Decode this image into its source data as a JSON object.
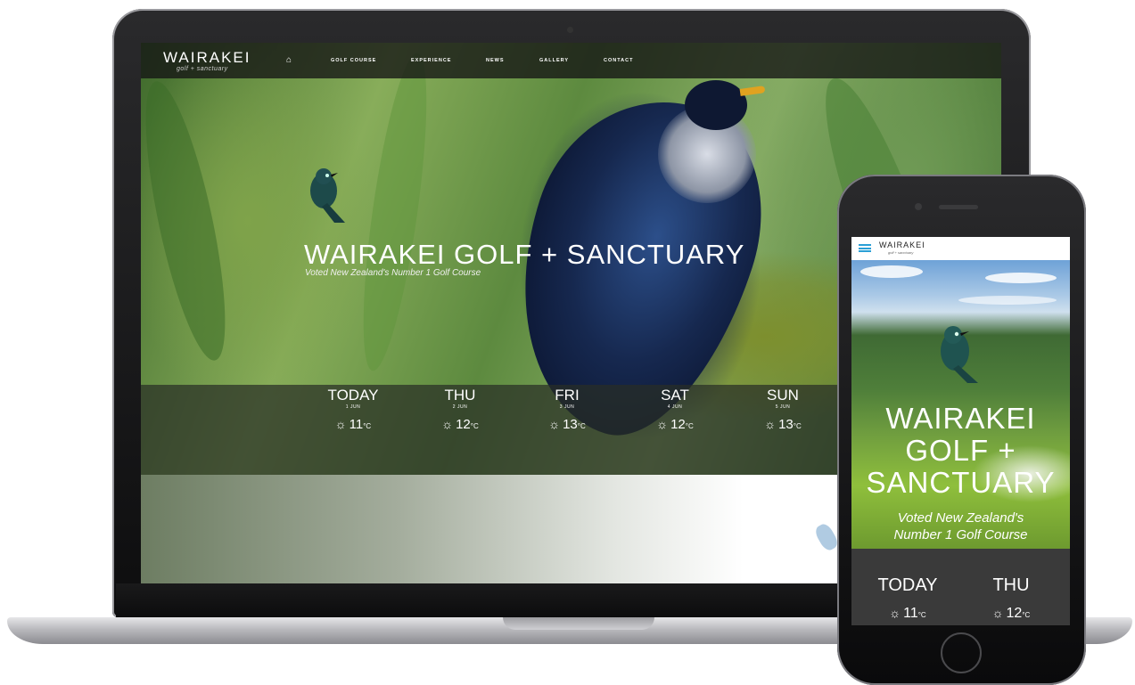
{
  "desktop": {
    "logo": {
      "main": "WAIRAKEI",
      "sub": "golf + sanctuary"
    },
    "nav": {
      "home_icon": "home-icon",
      "items": [
        "GOLF COURSE",
        "EXPERIENCE",
        "NEWS",
        "GALLERY",
        "CONTACT"
      ]
    },
    "hero": {
      "title": "WAIRAKEI GOLF + SANCTUARY",
      "subtitle": "Voted New Zealand's Number 1 Golf Course"
    },
    "weather": [
      {
        "day": "TODAY",
        "date": "1 JUN",
        "temp": "11",
        "unit": "°C",
        "icon": "sun-icon"
      },
      {
        "day": "THU",
        "date": "2 JUN",
        "temp": "12",
        "unit": "°C",
        "icon": "sun-icon"
      },
      {
        "day": "FRI",
        "date": "3 JUN",
        "temp": "13",
        "unit": "°C",
        "icon": "sun-icon"
      },
      {
        "day": "SAT",
        "date": "4 JUN",
        "temp": "12",
        "unit": "°C",
        "icon": "sun-icon"
      },
      {
        "day": "SUN",
        "date": "5 JUN",
        "temp": "13",
        "unit": "°C",
        "icon": "sun-icon"
      }
    ]
  },
  "mobile": {
    "logo": {
      "main": "WAIRAKEI",
      "sub": "golf + sanctuary"
    },
    "menu_icon": "hamburger-menu-icon",
    "hero": {
      "title_lines": [
        "WAIRAKEI",
        "GOLF +",
        "SANCTUARY"
      ],
      "subtitle_lines": [
        "Voted New Zealand's",
        "Number 1 Golf Course"
      ]
    },
    "weather": [
      {
        "day": "TODAY",
        "temp": "11",
        "unit": "°C",
        "icon": "sun-icon"
      },
      {
        "day": "THU",
        "temp": "12",
        "unit": "°C",
        "icon": "sun-icon"
      }
    ]
  },
  "colors": {
    "accent_blue": "#2a9fd6",
    "beak_orange": "#e0a220",
    "weather_bar": "#3a3a3a"
  }
}
